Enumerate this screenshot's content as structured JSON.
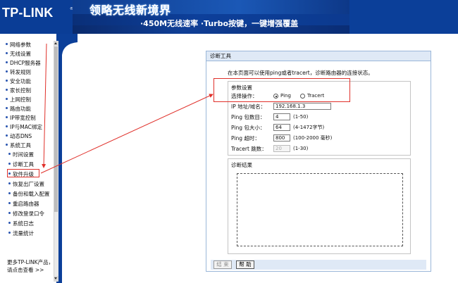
{
  "header": {
    "logo": "TP-LINK",
    "logo_mark": "®",
    "banner_title": "领略无线新境界",
    "banner_subtitle": "·450M无线速率  ·Turbo按键，一键增强覆盖"
  },
  "sidebar": {
    "items": [
      {
        "label": "网络参数"
      },
      {
        "label": "无线设置"
      },
      {
        "label": "DHCP服务器"
      },
      {
        "label": "转发规则"
      },
      {
        "label": "安全功能"
      },
      {
        "label": "家长控制"
      },
      {
        "label": "上网控制"
      },
      {
        "label": "路由功能"
      },
      {
        "label": "IP带宽控制"
      },
      {
        "label": "IP与MAC绑定"
      },
      {
        "label": "动态DNS"
      },
      {
        "label": "系统工具"
      }
    ],
    "sub_items": [
      {
        "label": "时间设置"
      },
      {
        "label": "诊断工具"
      },
      {
        "label": "软件升级"
      },
      {
        "label": "恢复出厂设置"
      },
      {
        "label": "备份和载入配置"
      },
      {
        "label": "重启路由器"
      },
      {
        "label": "修改登录口令"
      },
      {
        "label": "系统日志"
      },
      {
        "label": "流量统计"
      }
    ],
    "more_line1": "更多TP-LINK产品，",
    "more_line2": "请点击查看 >>"
  },
  "panel": {
    "title": "诊断工具",
    "description": "在本页面可以使用ping或者tracert，诊断路由器的连接状态。",
    "params_legend": "参数设置",
    "operation_label": "选择操作：",
    "radio_ping": "Ping",
    "radio_tracert": "Tracert",
    "selected_operation": "Ping",
    "ip_label": "IP 地址/域名：",
    "ip_value": "192.168.1.3",
    "ping_count_label": "Ping 包数目：",
    "ping_count_value": "4",
    "ping_count_hint": "(1-50)",
    "ping_size_label": "Ping 包大小：",
    "ping_size_value": "64",
    "ping_size_hint": "(4-1472字节)",
    "ping_timeout_label": "Ping 超时：",
    "ping_timeout_value": "800",
    "ping_timeout_hint": "(100-2000 毫秒)",
    "tracert_hops_label": "Tracert 跳数：",
    "tracert_hops_value": "20",
    "tracert_hops_hint": "(1-30)",
    "results_legend": "诊断结果",
    "btn_clear": "结 束",
    "btn_help": "帮 助"
  },
  "colors": {
    "header_blue": "#0b3f99",
    "panel_title_bg": "#dfe9f6",
    "annotation_red": "#e0302a"
  }
}
